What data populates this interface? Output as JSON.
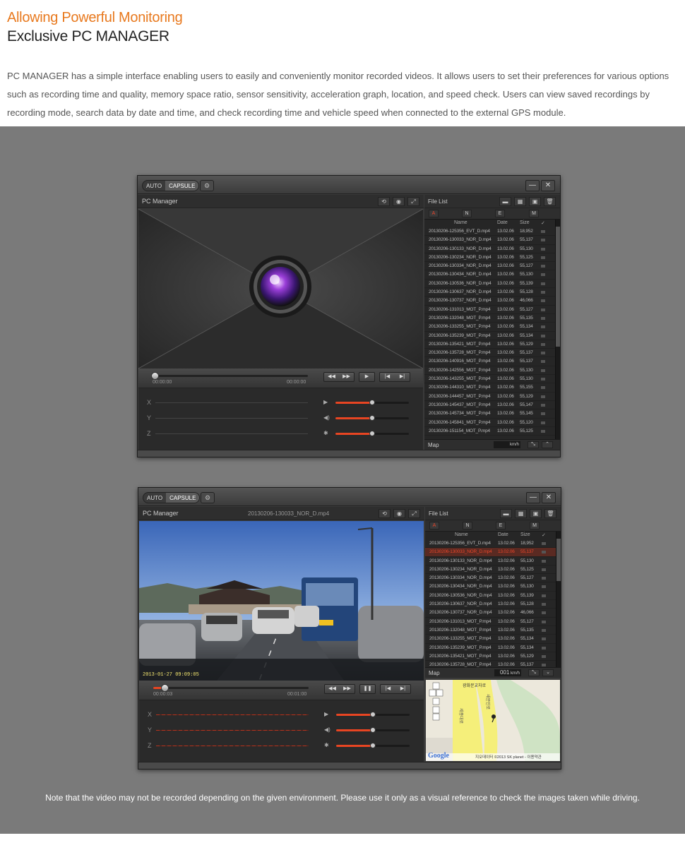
{
  "header": {
    "subtitle": "Allowing Powerful Monitoring",
    "title": "Exclusive PC MANAGER",
    "description_lead": "PC MANAGER",
    "description": " has a simple interface enabling users to easily and conveniently monitor recorded videos. It allows users to set their preferences for various options such as recording time and quality, memory space ratio, sensor sensitivity, acceleration graph, location, and speed check. Users can view saved recordings by recording mode, search data by date and time, and check recording time and vehicle speed when connected to the external GPS module."
  },
  "footer_note": "Note that the video may not be recorded depending on the given environment. Please use it only as a visual reference to check the images taken while driving.",
  "app": {
    "mode_auto": "AUTO",
    "mode_capsule": "CAPSULE",
    "gear_glyph": "⚙",
    "minimize_glyph": "—",
    "close_glyph": "✕",
    "panel_title": "PC Manager",
    "file_list_title": "File List",
    "filters": [
      "A",
      "N",
      "E",
      "M"
    ],
    "col_name": "Name",
    "col_date": "Date",
    "col_size": "Size",
    "check_glyph": "✓",
    "axes": [
      "X",
      "Y",
      "Z"
    ],
    "map_title": "Map",
    "tool_glyphs": [
      "⟲",
      "◉",
      "⤢"
    ],
    "file_tool_glyphs": [
      "▬",
      "▦",
      "▣",
      "🗑"
    ],
    "play_glyphs": [
      "◀◀",
      "▶▶"
    ],
    "skip_glyphs": [
      "|◀",
      "▶|"
    ],
    "sensor_icons": [
      "▶",
      "◀)",
      "✱"
    ]
  },
  "window1": {
    "time_start": "00:00:00",
    "time_end": "00:00:00",
    "play_glyph": "▶",
    "speed_unit": "km/h",
    "progress": 0.0
  },
  "window2": {
    "file_name": "20130206-130033_NOR_D.mp4",
    "time_start": "00:00:03",
    "time_end": "00:01:00",
    "play_glyph": "❚❚",
    "speed_value": "001",
    "speed_unit": "km/h",
    "video_timestamp": "2013-01-27  09:09:05",
    "progress": 0.05,
    "map_copyright": "지오데이터 ©2013 SK planet - 이용약관",
    "google_label": "Google",
    "map_road1": "세종대로",
    "map_road2": "새문안로",
    "map_place": "광화문교차로"
  },
  "files": [
    {
      "name": "20130206-125356_EVT_D.mp4",
      "date": "13.02.06",
      "size": "18,952"
    },
    {
      "name": "20130206-130033_NOR_D.mp4",
      "date": "13.02.06",
      "size": "55,137"
    },
    {
      "name": "20130206-130133_NOR_D.mp4",
      "date": "13.02.06",
      "size": "55,130"
    },
    {
      "name": "20130206-130234_NOR_D.mp4",
      "date": "13.02.06",
      "size": "55,125"
    },
    {
      "name": "20130206-130334_NOR_D.mp4",
      "date": "13.02.06",
      "size": "55,127"
    },
    {
      "name": "20130206-130434_NOR_D.mp4",
      "date": "13.02.06",
      "size": "55,130"
    },
    {
      "name": "20130206-130536_NOR_D.mp4",
      "date": "13.02.06",
      "size": "55,139"
    },
    {
      "name": "20130206-130637_NOR_D.mp4",
      "date": "13.02.06",
      "size": "55,128"
    },
    {
      "name": "20130206-130737_NOR_D.mp4",
      "date": "13.02.06",
      "size": "46,066"
    },
    {
      "name": "20130206-131013_MOT_P.mp4",
      "date": "13.02.06",
      "size": "55,127"
    },
    {
      "name": "20130206-132048_MOT_P.mp4",
      "date": "13.02.06",
      "size": "55,135"
    },
    {
      "name": "20130206-133255_MOT_P.mp4",
      "date": "13.02.06",
      "size": "55,134"
    },
    {
      "name": "20130206-135239_MOT_P.mp4",
      "date": "13.02.06",
      "size": "55,134"
    },
    {
      "name": "20130206-135421_MOT_P.mp4",
      "date": "13.02.06",
      "size": "55,129"
    },
    {
      "name": "20130206-135728_MOT_P.mp4",
      "date": "13.02.06",
      "size": "55,137"
    },
    {
      "name": "20130206-140916_MOT_P.mp4",
      "date": "13.02.06",
      "size": "55,137"
    },
    {
      "name": "20130206-142556_MOT_P.mp4",
      "date": "13.02.06",
      "size": "55,130"
    },
    {
      "name": "20130206-143255_MOT_P.mp4",
      "date": "13.02.06",
      "size": "55,130"
    },
    {
      "name": "20130206-144310_MOT_P.mp4",
      "date": "13.02.06",
      "size": "55,155"
    },
    {
      "name": "20130206-144457_MOT_P.mp4",
      "date": "13.02.06",
      "size": "55,129"
    },
    {
      "name": "20130206-145437_MOT_P.mp4",
      "date": "13.02.06",
      "size": "55,147"
    },
    {
      "name": "20130206-145734_MOT_P.mp4",
      "date": "13.02.06",
      "size": "55,145"
    },
    {
      "name": "20130206-145841_MOT_P.mp4",
      "date": "13.02.06",
      "size": "55,120"
    },
    {
      "name": "20130206-151154_MOT_P.mp4",
      "date": "13.02.06",
      "size": "55,125"
    }
  ],
  "colors": {
    "accent": "#e8791e",
    "slider": "#e84522",
    "selected_row": "#e8452a"
  }
}
